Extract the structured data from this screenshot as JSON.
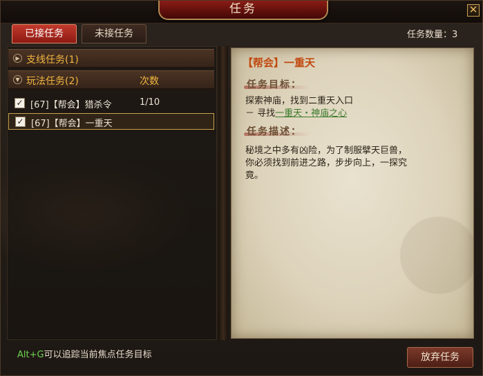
{
  "window": {
    "title": "任务"
  },
  "tabs": [
    {
      "label": "已接任务",
      "active": true
    },
    {
      "label": "未接任务",
      "active": false
    }
  ],
  "quest_count": "任务数量：3",
  "categories": [
    {
      "label": "支线任务(1)",
      "expanded": false
    },
    {
      "label": "玩法任务(2)",
      "expanded": true,
      "column_header": "次数"
    }
  ],
  "quests": [
    {
      "label": "[67]【帮会】猎杀令",
      "count": "1/10",
      "checked": true,
      "selected": false
    },
    {
      "label": "[67]【帮会】一重天",
      "count": "",
      "checked": true,
      "selected": true
    }
  ],
  "detail": {
    "title": "【帮会】一重天",
    "objective_header": "任务目标：",
    "objective_text": "探索神庙，找到二重天入口",
    "objective_sub_prefix": "－ 寻找",
    "objective_link": "一重天・神庙之心",
    "description_header": "任务描述：",
    "description_line1": "秘境之中多有凶险，为了制服擘天巨兽，",
    "description_line2": "你必须找到前进之路，步步向上，一探究",
    "description_line3": "竟。"
  },
  "footer": {
    "hint_key": "Alt+G",
    "hint_text": "可以追踪当前焦点任务目标",
    "abandon_label": "放弃任务"
  },
  "icons": {
    "close": "close-icon",
    "check": "checkmark-icon",
    "expand": "chevron-down-icon",
    "collapse": "chevron-right-icon"
  },
  "colors": {
    "accent_orange": "#f2b640",
    "title_red": "#8c1a12",
    "link_green": "#3b7a2a"
  }
}
